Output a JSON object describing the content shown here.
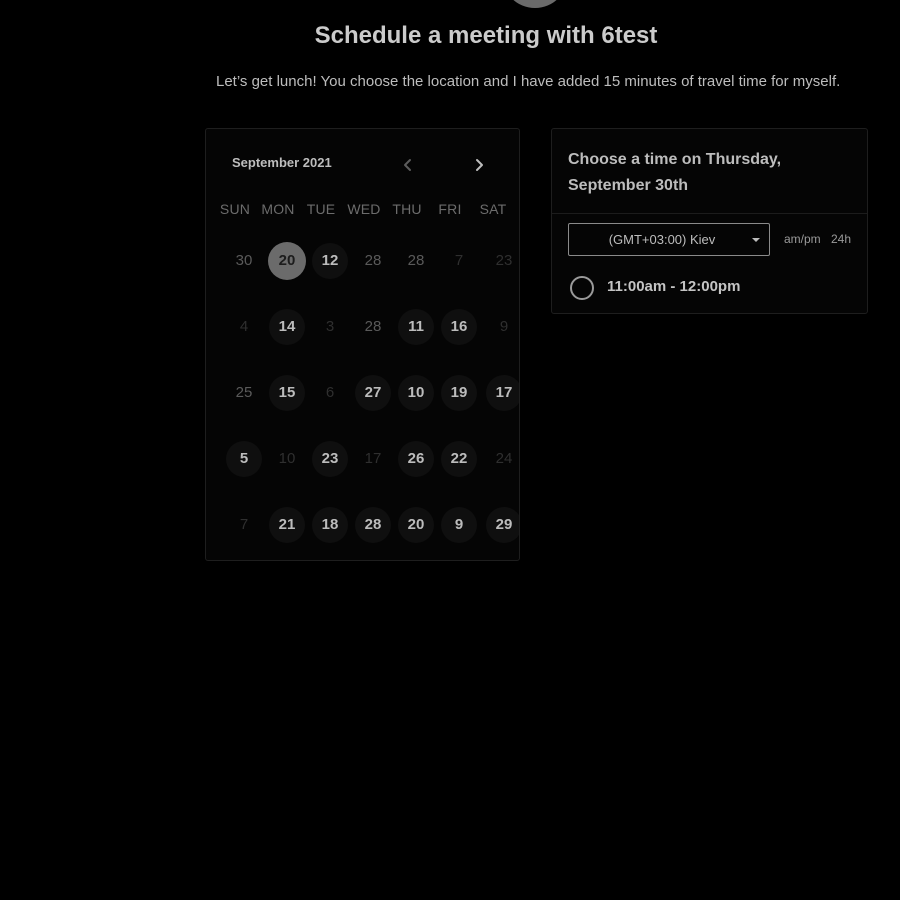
{
  "header": {
    "title": "Schedule a meeting with 6test",
    "description": "Let’s get lunch! You choose the location and I have added 15 minutes of travel time for myself."
  },
  "calendar": {
    "month_label": "September 2021",
    "prev_icon": "chevron-left-icon",
    "next_icon": "chevron-right-icon",
    "weekdays": [
      "SUN",
      "MON",
      "TUE",
      "WED",
      "THU",
      "FRI",
      "SAT"
    ],
    "selected_day": "20",
    "weeks": [
      [
        {
          "label": "30",
          "state": "dim"
        },
        {
          "label": "20",
          "state": "selected"
        },
        {
          "label": "12",
          "state": "available"
        },
        {
          "label": "28",
          "state": "dim"
        },
        {
          "label": "28",
          "state": "dim"
        },
        {
          "label": "7",
          "state": "faint"
        },
        {
          "label": "23",
          "state": "faint"
        }
      ],
      [
        {
          "label": "4",
          "state": "faint"
        },
        {
          "label": "14",
          "state": "available"
        },
        {
          "label": "3",
          "state": "faint"
        },
        {
          "label": "28",
          "state": "dim"
        },
        {
          "label": "11",
          "state": "available"
        },
        {
          "label": "16",
          "state": "available"
        },
        {
          "label": "9",
          "state": "faint"
        }
      ],
      [
        {
          "label": "25",
          "state": "dim"
        },
        {
          "label": "15",
          "state": "available"
        },
        {
          "label": "6",
          "state": "faint"
        },
        {
          "label": "27",
          "state": "available"
        },
        {
          "label": "10",
          "state": "available"
        },
        {
          "label": "19",
          "state": "available"
        },
        {
          "label": "17",
          "state": "available"
        }
      ],
      [
        {
          "label": "5",
          "state": "available"
        },
        {
          "label": "10",
          "state": "faint"
        },
        {
          "label": "23",
          "state": "available"
        },
        {
          "label": "17",
          "state": "faint"
        },
        {
          "label": "26",
          "state": "available"
        },
        {
          "label": "22",
          "state": "available"
        },
        {
          "label": "24",
          "state": "faint"
        }
      ],
      [
        {
          "label": "7",
          "state": "faint"
        },
        {
          "label": "21",
          "state": "available"
        },
        {
          "label": "18",
          "state": "available"
        },
        {
          "label": "28",
          "state": "available"
        },
        {
          "label": "20",
          "state": "available"
        },
        {
          "label": "9",
          "state": "available"
        },
        {
          "label": "29",
          "state": "available"
        }
      ]
    ]
  },
  "time_panel": {
    "heading": "Choose a time on Thursday, September 30th",
    "timezone": "(GMT+03:00) Kiev",
    "timezone_icon": "caret-down-icon",
    "format_ampm": "am/pm",
    "format_24h": "24h",
    "slots": [
      {
        "label": "11:00am - 12:00pm"
      }
    ]
  },
  "colors": {
    "background": "#000000",
    "panel": "#050505",
    "selected_day": "#6b6b6b",
    "text": "#bdbdbd"
  }
}
